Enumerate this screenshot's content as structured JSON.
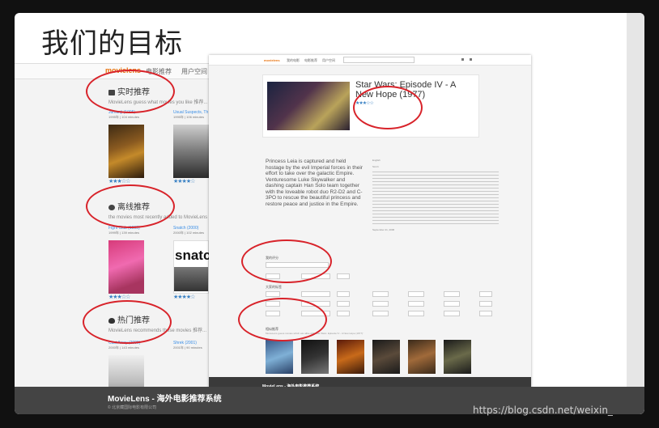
{
  "slide": {
    "title": "我们的目标"
  },
  "left_app": {
    "nav": {
      "logo": "movielens",
      "menu1": "电影推荐",
      "menu2": "用户空间"
    },
    "sections": [
      {
        "title": "实时推荐",
        "desc": "MovieLens guess what movies you like 推荐...",
        "icon": "video-icon"
      },
      {
        "title": "离线推荐",
        "desc": "the movies most recently added to MovieLens 更",
        "icon": "heart-icon"
      },
      {
        "title": "热门推荐",
        "desc": "MovieLens recommends these movies 推荐...",
        "icon": "fire-icon"
      }
    ],
    "row1": [
      {
        "title": "Jumanji (1995)",
        "sub": "1995年 | 104 minutes",
        "stars": "★★★☆☆"
      },
      {
        "title": "Usual Suspects, Th",
        "sub": "1995年 | 106 minutes",
        "stars": "★★★★☆"
      }
    ],
    "row2": [
      {
        "title": "Fight Club (1999)",
        "sub": "1999年 | 139 minutes",
        "stars": "★★★☆☆"
      },
      {
        "title": "Snatch (2000)",
        "sub": "2000年 | 102 minutes",
        "stars": "★★★★☆"
      }
    ],
    "row3": [
      {
        "title": "Cast Away (2000)",
        "sub": "2000年 | 143 minutes"
      },
      {
        "title": "Shrek (2001)",
        "sub": "2001年 | 90 minutes"
      }
    ],
    "poster_text": {
      "p3": "snatc"
    }
  },
  "right_app": {
    "nav": {
      "logo": "movielens",
      "m1": "我的电影",
      "m2": "电影推荐",
      "m3": "用户空间"
    },
    "movie": {
      "title": "Star Wars: Episode IV - A New Hope (1977)",
      "stars": "★★★☆☆",
      "plot": "Princess Leia is captured and held hostage by the evil Imperial forces in their effort to take over the galactic Empire. Venturesome Luke Skywalker and dashing captain Han Solo team together with the loveable robot duo R2-D2 and C-3PO to rescue the beautiful princess and restore peace and justice in the Empire.",
      "side_date": "September 21, 2006",
      "side_lang": "English",
      "side_genre": "Sci-Fi"
    },
    "sections": {
      "rate": "我的评分",
      "tags": "大家的标签",
      "similar": "相似推荐",
      "similar_desc": "MovieLens guess movies which are alike with 'Star Wars: Episode IV - A New Hope (1977)'"
    },
    "footer": {
      "title": "MovieLens - 海外电影推荐系统",
      "sub": "© 北京藏国际电影有限公司"
    }
  },
  "footer": {
    "title": "MovieLens - 海外电影推荐系统",
    "sub": "© 北京藏国际电影有限公司"
  },
  "watermark": "https://blog.csdn.net/weixin_"
}
